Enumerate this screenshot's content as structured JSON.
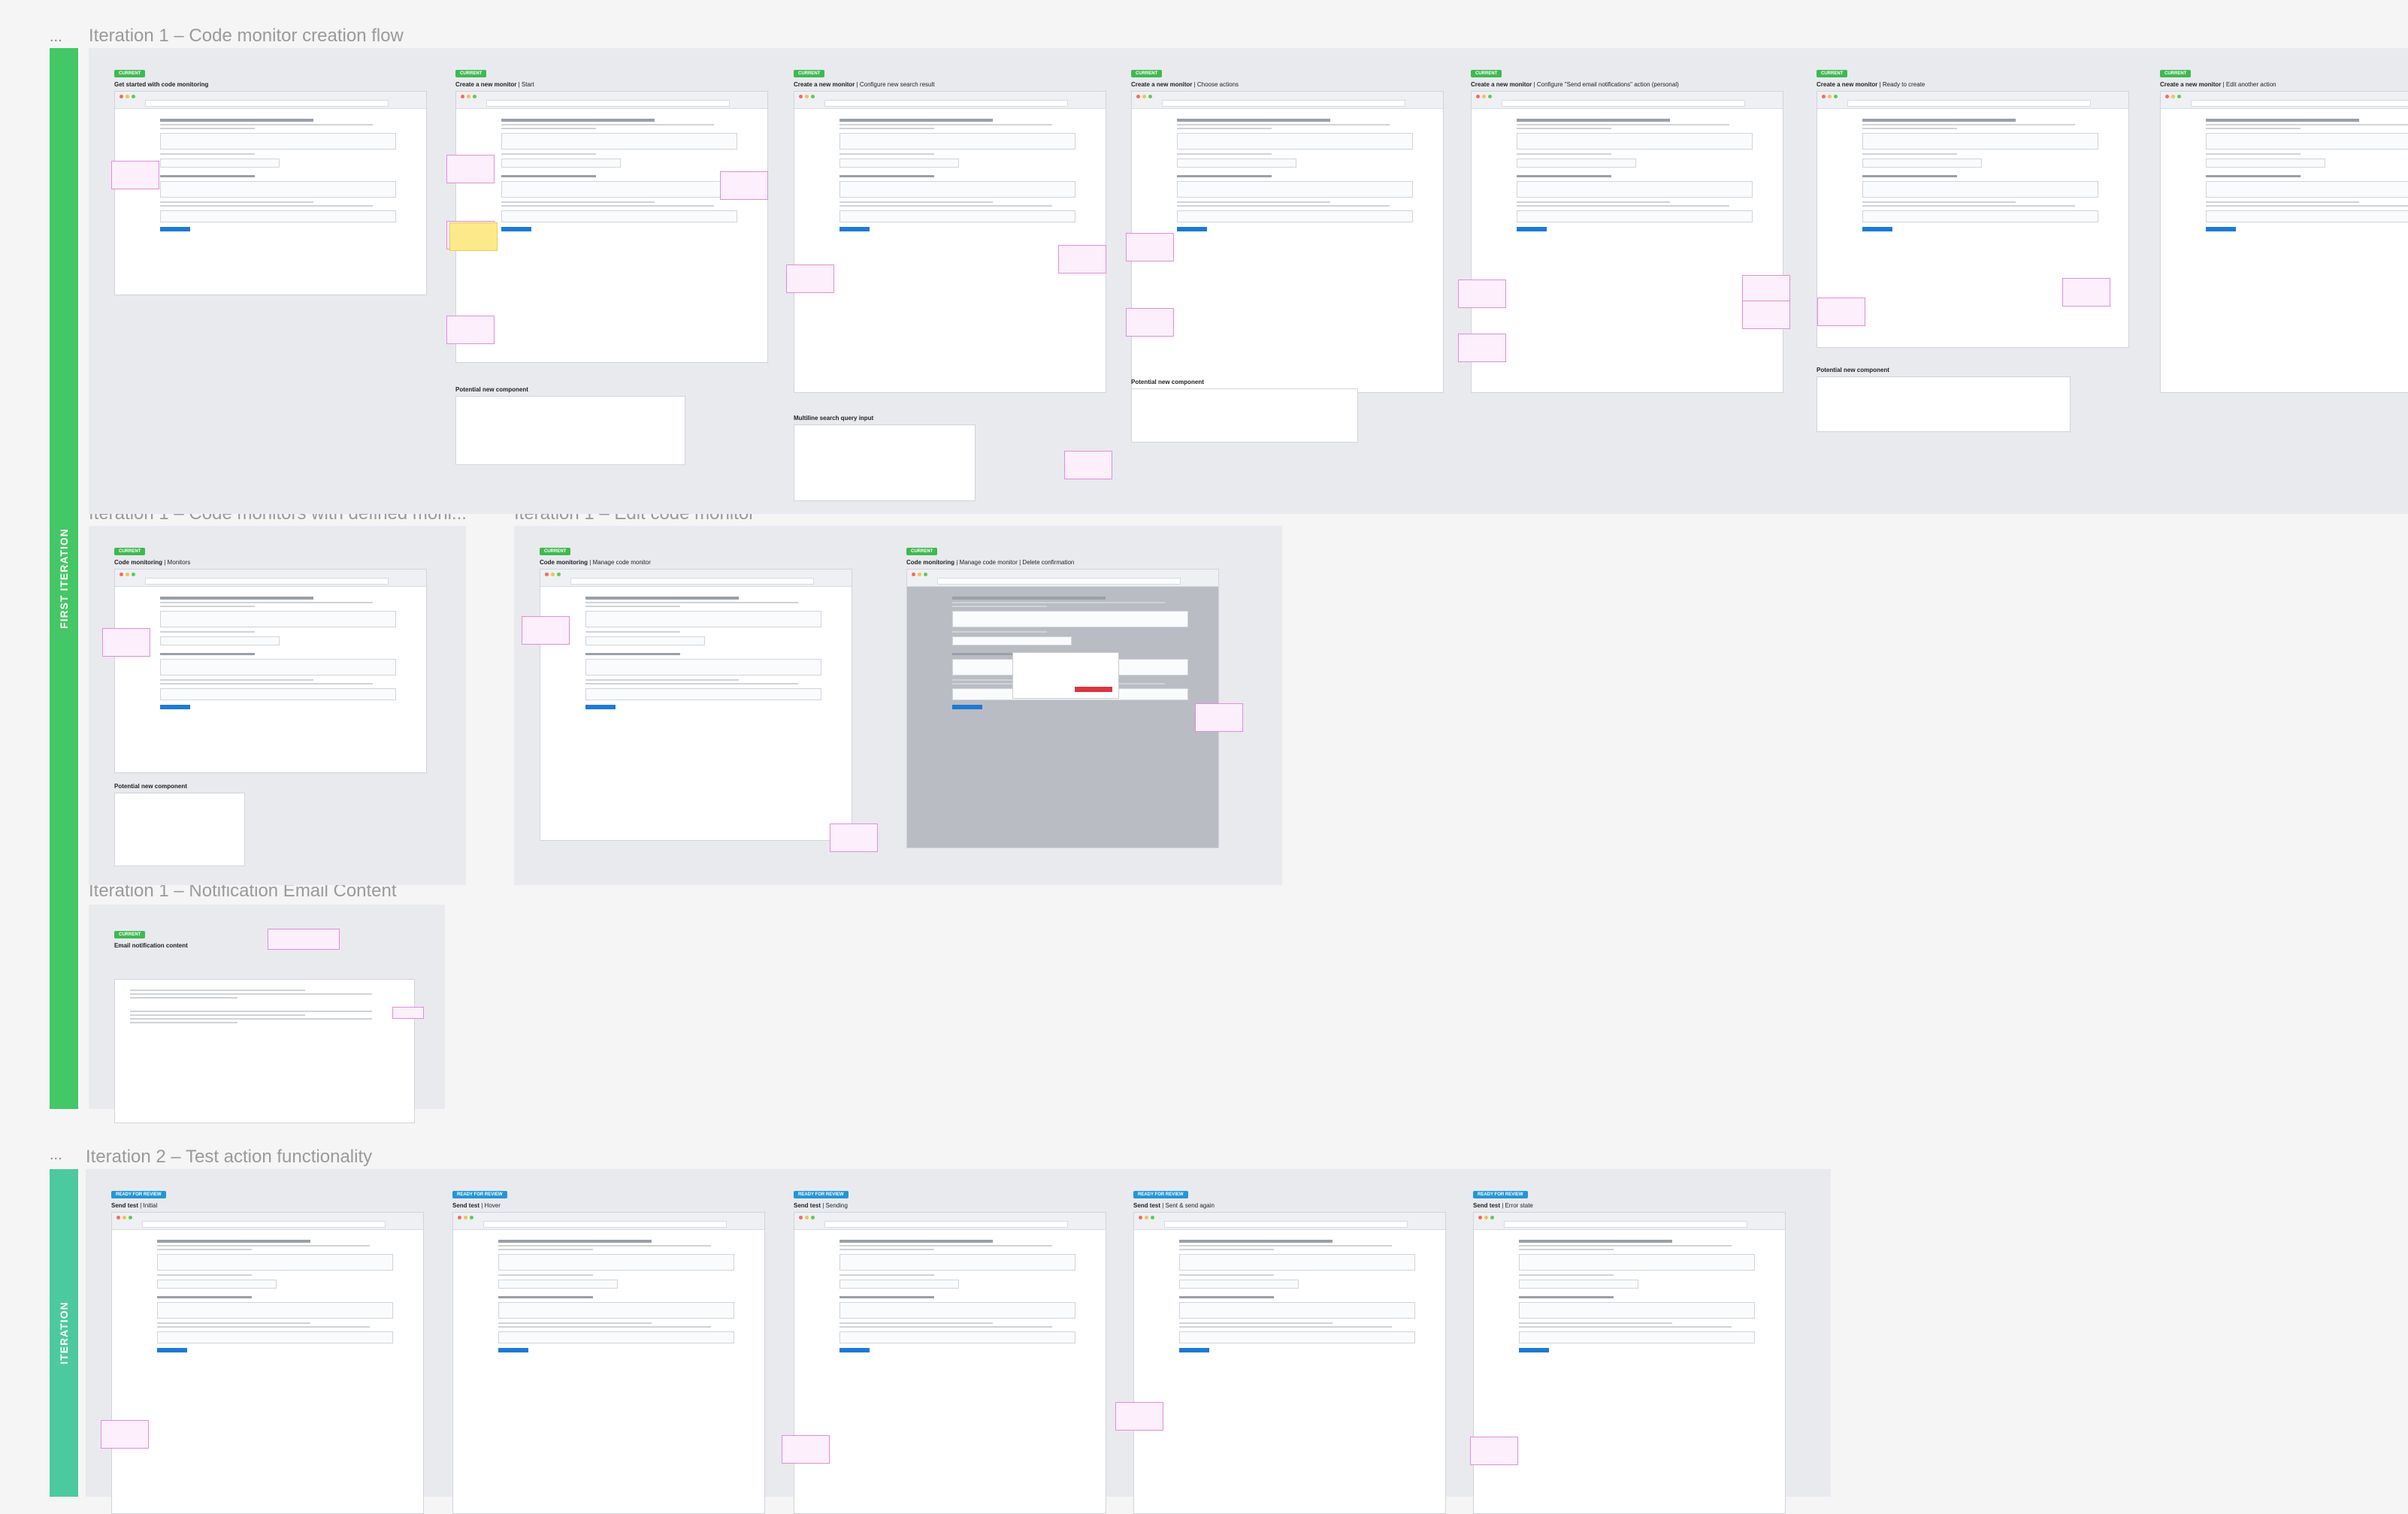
{
  "rails": [
    {
      "label": "FIRST ITERATION",
      "color": "#44c766"
    },
    {
      "label": "ITERATION",
      "color": "#4dc9a0"
    }
  ],
  "sections": {
    "s1": "Iteration 1 – Code monitor creation flow",
    "s2": "Iteration 1 – Code monitors with defined moni...",
    "s3": "Iteration 1 – Edit code monitor",
    "s4": "Iteration 1 – Notification Email Content",
    "s5": "Iteration 2 – Test action functionality"
  },
  "ellipsis": "...",
  "status_tags": {
    "current": "CURRENT",
    "ready": "READY FOR REVIEW"
  },
  "potential_component": "Potential new component",
  "multiline_label": "Multiline search query input",
  "row1": [
    {
      "title": "Get started with code monitoring",
      "sub": ""
    },
    {
      "title": "Create a new monitor",
      "sub": " | Start"
    },
    {
      "title": "Create a new monitor",
      "sub": " | Configure new search result"
    },
    {
      "title": "Create a new monitor",
      "sub": " | Choose actions"
    },
    {
      "title": "Create a new monitor",
      "sub": " | Configure \"Send email notifications\" action (personal)"
    },
    {
      "title": "Create a new monitor",
      "sub": " | Ready to create"
    },
    {
      "title": "Create a new monitor",
      "sub": " | Edit another action"
    }
  ],
  "row2": [
    {
      "title": "Code monitoring",
      "sub": " | Monitors"
    },
    {
      "title": "Code monitoring",
      "sub": " | Manage code monitor"
    },
    {
      "title": "Code monitoring",
      "sub": " | Manage code monitor | Delete confirmation"
    }
  ],
  "email": {
    "title": "Email notification content"
  },
  "row3": [
    {
      "title": "Send test",
      "sub": " | Initial"
    },
    {
      "title": "Send test",
      "sub": " | Hover"
    },
    {
      "title": "Send test",
      "sub": " | Sending"
    },
    {
      "title": "Send test",
      "sub": " | Sent & send again"
    },
    {
      "title": "Send test",
      "sub": " | Error state"
    }
  ]
}
